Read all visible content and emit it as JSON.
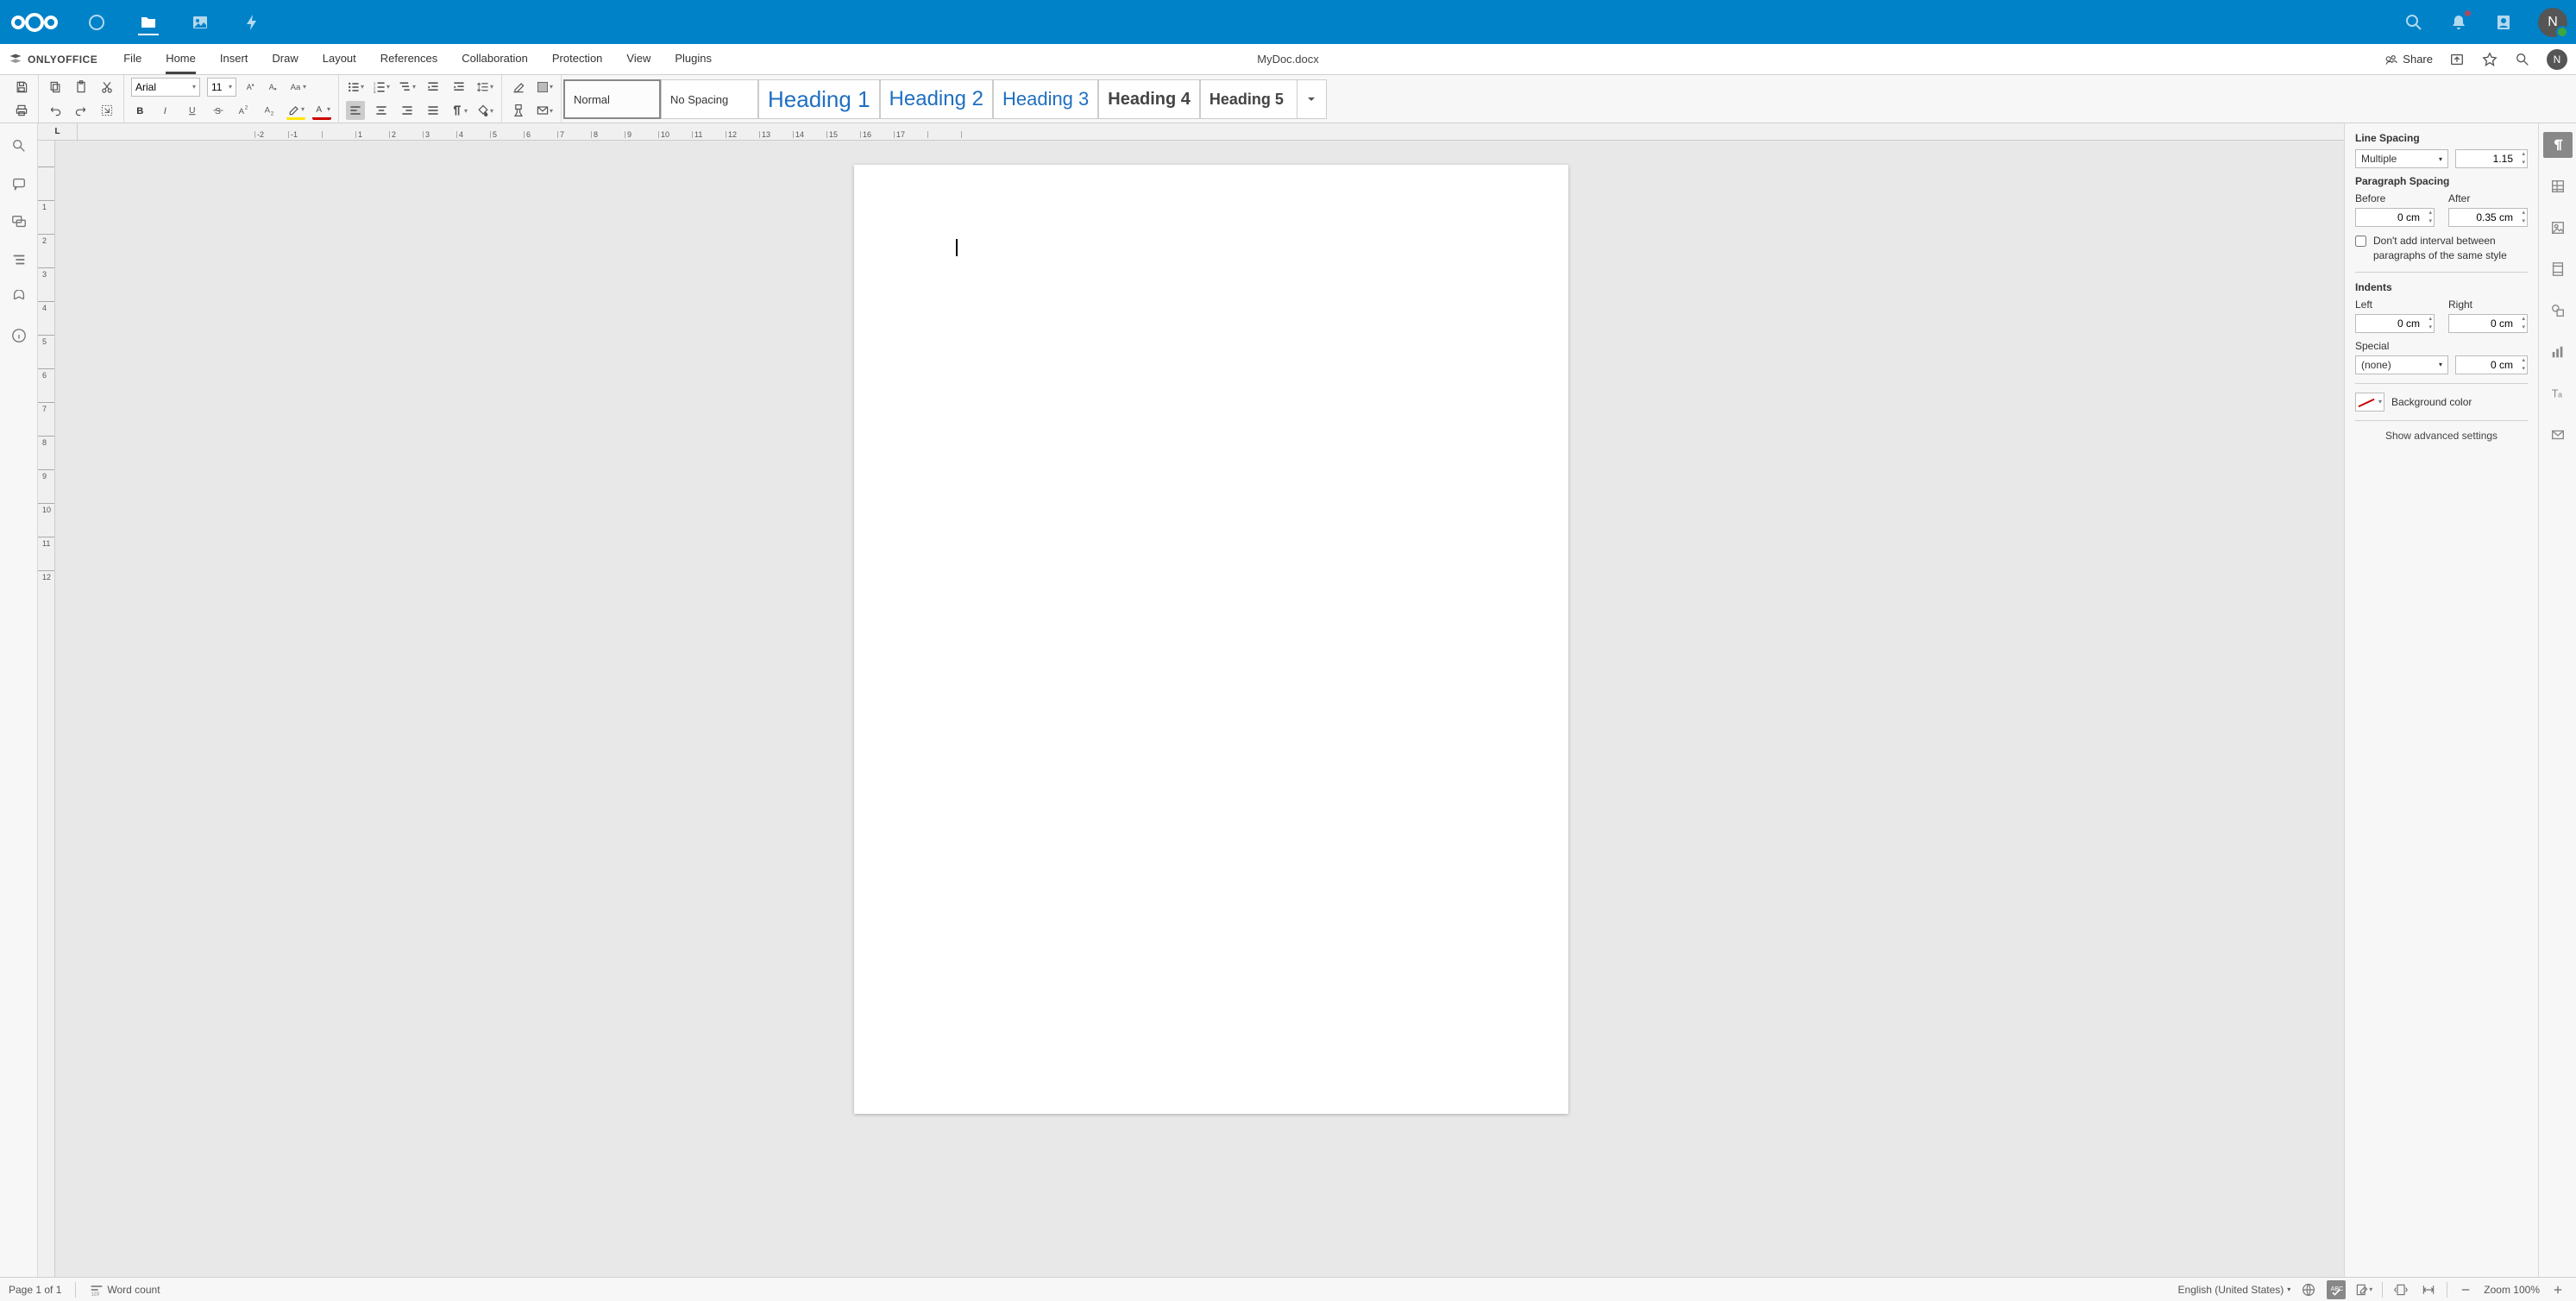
{
  "nc": {
    "avatar_initial": "N"
  },
  "oo": {
    "brand": "ONLYOFFICE",
    "menus": [
      "File",
      "Home",
      "Insert",
      "Draw",
      "Layout",
      "References",
      "Collaboration",
      "Protection",
      "View",
      "Plugins"
    ],
    "active_menu_index": 1,
    "docname": "MyDoc.docx",
    "share_label": "Share",
    "avatar_initial": "N"
  },
  "ribbon": {
    "font_name": "Arial",
    "font_size": "11",
    "styles": [
      {
        "name": "Normal",
        "cls": "",
        "selected": true
      },
      {
        "name": "No Spacing",
        "cls": ""
      },
      {
        "name": "Heading 1",
        "cls": "h1"
      },
      {
        "name": "Heading 2",
        "cls": "h2"
      },
      {
        "name": "Heading 3",
        "cls": "h3"
      },
      {
        "name": "Heading 4",
        "cls": "h4"
      },
      {
        "name": "Heading 5",
        "cls": "h5"
      }
    ]
  },
  "ruler": {
    "h": [
      -2,
      -1,
      "",
      1,
      2,
      3,
      4,
      5,
      6,
      7,
      8,
      9,
      10,
      11,
      12,
      13,
      14,
      15,
      16,
      17,
      "",
      ""
    ],
    "v": [
      "",
      1,
      2,
      3,
      4,
      5,
      6,
      7,
      8,
      9,
      10,
      11,
      12
    ]
  },
  "panel": {
    "line_spacing_label": "Line Spacing",
    "line_spacing_mode": "Multiple",
    "line_spacing_value": "1.15",
    "para_spacing_label": "Paragraph Spacing",
    "before_label": "Before",
    "after_label": "After",
    "before_value": "0 cm",
    "after_value": "0.35 cm",
    "no_interval_label": "Don't add interval between paragraphs of the same style",
    "indents_label": "Indents",
    "left_label": "Left",
    "right_label": "Right",
    "left_value": "0 cm",
    "right_value": "0 cm",
    "special_label": "Special",
    "special_mode": "(none)",
    "special_value": "0 cm",
    "bg_label": "Background color",
    "advanced_label": "Show advanced settings"
  },
  "status": {
    "page": "Page 1 of 1",
    "wordcount": "Word count",
    "language": "English (United States)",
    "zoom": "Zoom 100%"
  }
}
